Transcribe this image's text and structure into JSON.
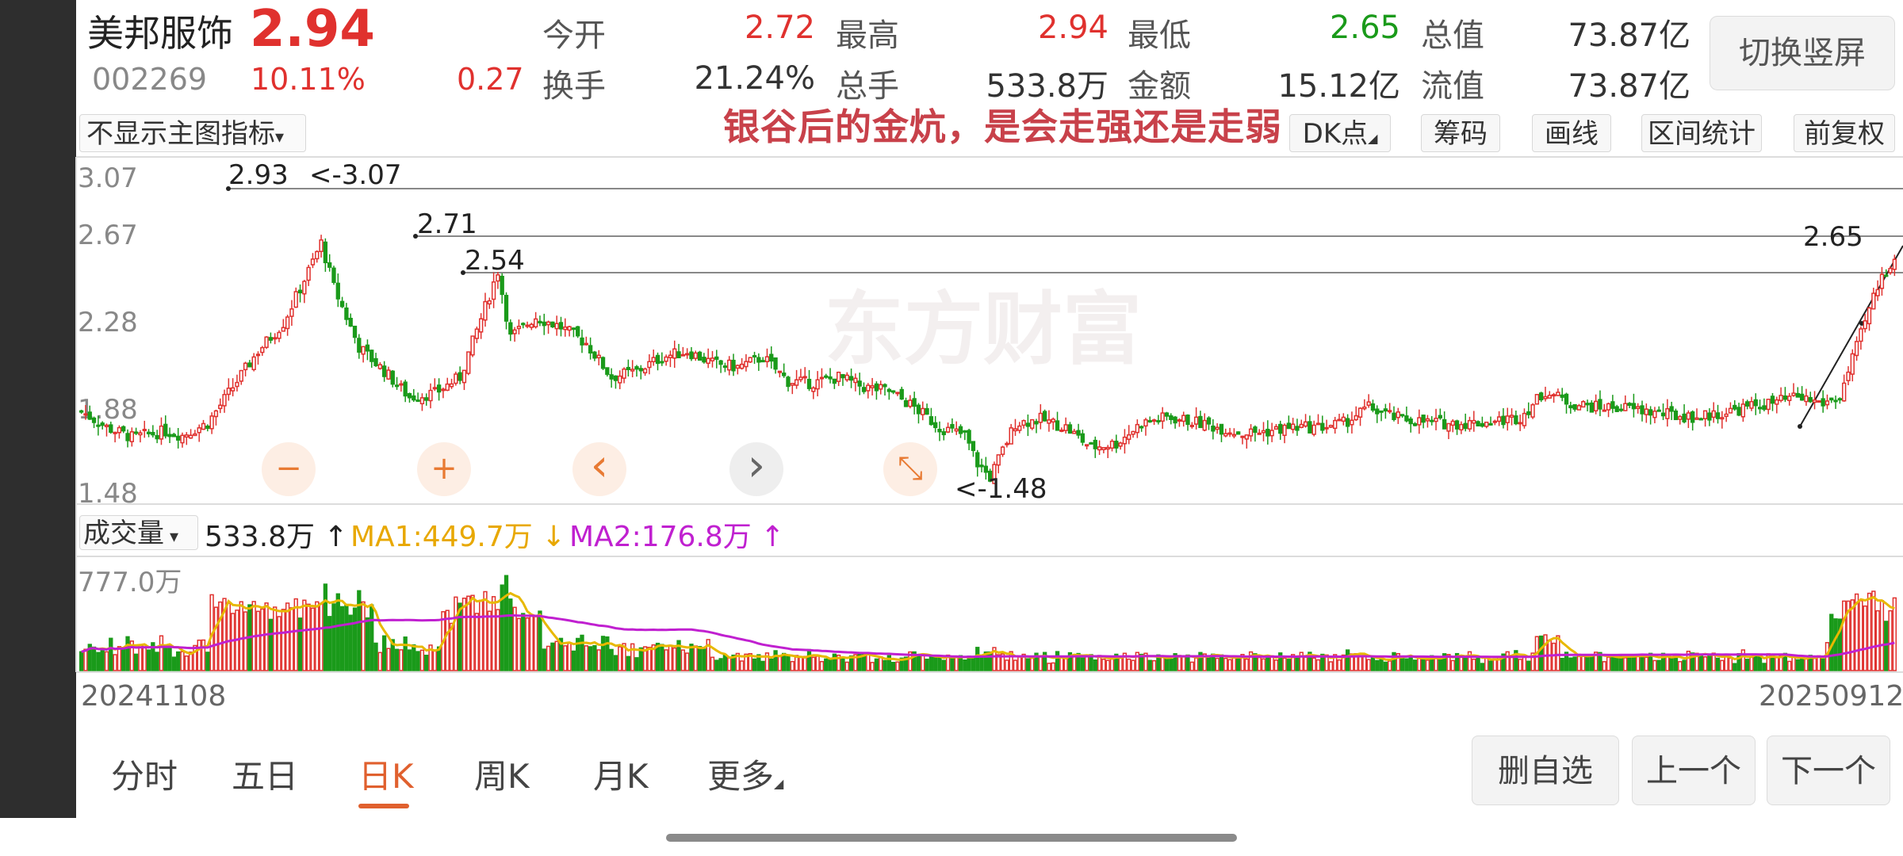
{
  "header": {
    "name": "美邦服饰",
    "price": "2.94",
    "code": "002269",
    "change_pct": "10.11%",
    "change": "0.27",
    "quotes": [
      {
        "label": "今开",
        "value": "2.72",
        "color": "red"
      },
      {
        "label": "最高",
        "value": "2.94",
        "color": "red"
      },
      {
        "label": "最低",
        "value": "2.65",
        "color": "green"
      },
      {
        "label": "总值",
        "value": "73.87亿",
        "color": "dark"
      },
      {
        "label": "换手",
        "value": "21.24%",
        "color": "dark"
      },
      {
        "label": "总手",
        "value": "533.8万",
        "color": "dark"
      },
      {
        "label": "金额",
        "value": "15.12亿",
        "color": "dark"
      },
      {
        "label": "流值",
        "value": "73.87亿",
        "color": "dark"
      }
    ],
    "switch_label": "切换竖屏"
  },
  "toolbar": {
    "indicator": "不显示主图指标",
    "annotation": "银谷后的金炕，是会走强还是走弱",
    "buttons": [
      "DK点",
      "筹码",
      "画线",
      "区间统计",
      "前复权"
    ]
  },
  "watermark": "东方财富",
  "price_axis": [
    "3.07",
    "2.67",
    "2.28",
    "1.88",
    "1.48"
  ],
  "price_marks": {
    "high": "<-3.07",
    "peak1": "2.93",
    "peak2": "2.71",
    "peak3": "2.54",
    "low": "<-1.48",
    "recent": "2.65"
  },
  "chart_controls": [
    {
      "name": "zoom-out-icon",
      "glyph": "−"
    },
    {
      "name": "zoom-in-icon",
      "glyph": "+"
    },
    {
      "name": "pan-left-icon",
      "glyph": "‹"
    },
    {
      "name": "pan-right-icon",
      "glyph": "›"
    },
    {
      "name": "collapse-icon",
      "glyph": "⤡"
    }
  ],
  "volume": {
    "select_label": "成交量",
    "value": "533.8万 ↑",
    "ma1": "MA1:449.7万 ↓",
    "ma2": "MA2:176.8万 ↑",
    "axis_max": "777.0万"
  },
  "dates": {
    "start": "20241108",
    "end": "20250912"
  },
  "tabs": [
    "分时",
    "五日",
    "日K",
    "周K",
    "月K",
    "更多"
  ],
  "bottom_buttons": [
    "删自选",
    "上一个",
    "下一个"
  ],
  "colors": {
    "up": "#e0312e",
    "down": "#1a9a1a",
    "ma1": "#e8b800",
    "ma2": "#c020d0",
    "accent": "#e0602e"
  },
  "chart_data": {
    "type": "candlestick",
    "ylim": [
      1.48,
      3.07
    ],
    "keypoints": [
      [
        0,
        1.88
      ],
      [
        6,
        1.8
      ],
      [
        12,
        1.75
      ],
      [
        20,
        1.78
      ],
      [
        24,
        1.76
      ],
      [
        30,
        1.82
      ],
      [
        36,
        2.0
      ],
      [
        42,
        2.18
      ],
      [
        48,
        2.32
      ],
      [
        54,
        2.58
      ],
      [
        57,
        2.72
      ],
      [
        60,
        2.5
      ],
      [
        66,
        2.2
      ],
      [
        72,
        2.08
      ],
      [
        78,
        1.95
      ],
      [
        84,
        1.97
      ],
      [
        90,
        2.05
      ],
      [
        96,
        2.4
      ],
      [
        99,
        2.58
      ],
      [
        102,
        2.25
      ],
      [
        108,
        2.35
      ],
      [
        114,
        2.3
      ],
      [
        120,
        2.22
      ],
      [
        126,
        2.05
      ],
      [
        132,
        2.08
      ],
      [
        138,
        2.15
      ],
      [
        144,
        2.18
      ],
      [
        150,
        2.12
      ],
      [
        156,
        2.1
      ],
      [
        162,
        2.15
      ],
      [
        168,
        2.03
      ],
      [
        174,
        2.02
      ],
      [
        180,
        2.05
      ],
      [
        186,
        2.0
      ],
      [
        192,
        1.98
      ],
      [
        198,
        1.9
      ],
      [
        204,
        1.8
      ],
      [
        210,
        1.76
      ],
      [
        213,
        1.62
      ],
      [
        216,
        1.55
      ],
      [
        222,
        1.82
      ],
      [
        228,
        1.84
      ],
      [
        234,
        1.8
      ],
      [
        240,
        1.7
      ],
      [
        246,
        1.72
      ],
      [
        252,
        1.82
      ],
      [
        258,
        1.85
      ],
      [
        264,
        1.83
      ],
      [
        270,
        1.8
      ],
      [
        276,
        1.77
      ],
      [
        282,
        1.78
      ],
      [
        288,
        1.8
      ],
      [
        294,
        1.8
      ],
      [
        300,
        1.82
      ],
      [
        306,
        1.9
      ],
      [
        312,
        1.85
      ],
      [
        318,
        1.83
      ],
      [
        324,
        1.82
      ],
      [
        330,
        1.82
      ],
      [
        336,
        1.83
      ],
      [
        342,
        1.85
      ],
      [
        348,
        1.98
      ],
      [
        354,
        1.92
      ],
      [
        360,
        1.9
      ],
      [
        366,
        1.9
      ],
      [
        372,
        1.88
      ],
      [
        378,
        1.86
      ],
      [
        384,
        1.85
      ],
      [
        390,
        1.87
      ],
      [
        396,
        1.9
      ],
      [
        402,
        1.92
      ],
      [
        408,
        1.95
      ],
      [
        414,
        1.92
      ],
      [
        418,
        1.95
      ],
      [
        422,
        2.2
      ],
      [
        426,
        2.45
      ],
      [
        428,
        2.55
      ],
      [
        431,
        2.65
      ]
    ]
  }
}
